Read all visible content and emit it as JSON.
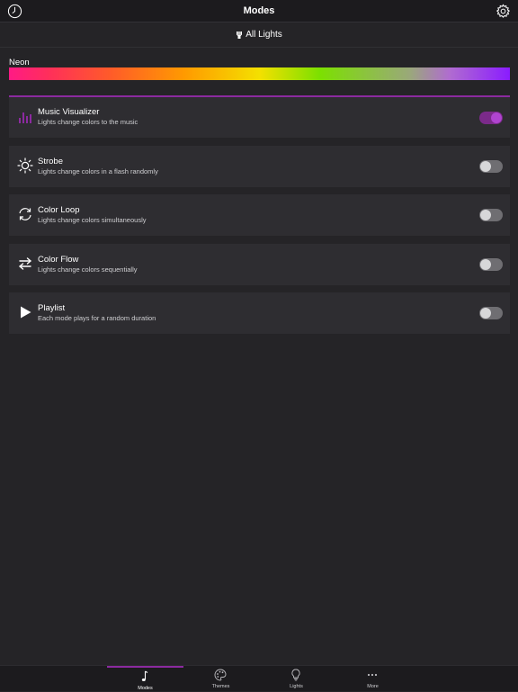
{
  "nav": {
    "title": "Modes",
    "left_icon": "clock-icon",
    "right_icon": "gear-icon"
  },
  "group_selector": {
    "label": "All Lights",
    "icon": "lightbulbs-icon"
  },
  "theme": {
    "name": "Neon",
    "gradient_colors": [
      "#ff1a85",
      "#ff5a2a",
      "#ff9a00",
      "#f4e000",
      "#7ce000",
      "#9aa87a",
      "#b06cd0",
      "#8a1cff"
    ]
  },
  "accent_color": "#8c2aa0",
  "modes": [
    {
      "title": "Music Visualizer",
      "desc": "Lights change colors to the music",
      "icon": "equalizer-icon",
      "enabled": true
    },
    {
      "title": "Strobe",
      "desc": "Lights change colors in a flash randomly",
      "icon": "sun-icon",
      "enabled": false
    },
    {
      "title": "Color Loop",
      "desc": "Lights change colors simultaneously",
      "icon": "loop-icon",
      "enabled": false
    },
    {
      "title": "Color Flow",
      "desc": "Lights change colors sequentially",
      "icon": "swap-arrows-icon",
      "enabled": false
    },
    {
      "title": "Playlist",
      "desc": "Each mode plays for a random duration",
      "icon": "play-icon",
      "enabled": false
    }
  ],
  "tabs": [
    {
      "label": "Modes",
      "icon": "music-note-icon",
      "active": true
    },
    {
      "label": "Themes",
      "icon": "palette-icon",
      "active": false
    },
    {
      "label": "Lights",
      "icon": "lightbulb-icon",
      "active": false
    },
    {
      "label": "More",
      "icon": "more-dots-icon",
      "active": false
    }
  ]
}
